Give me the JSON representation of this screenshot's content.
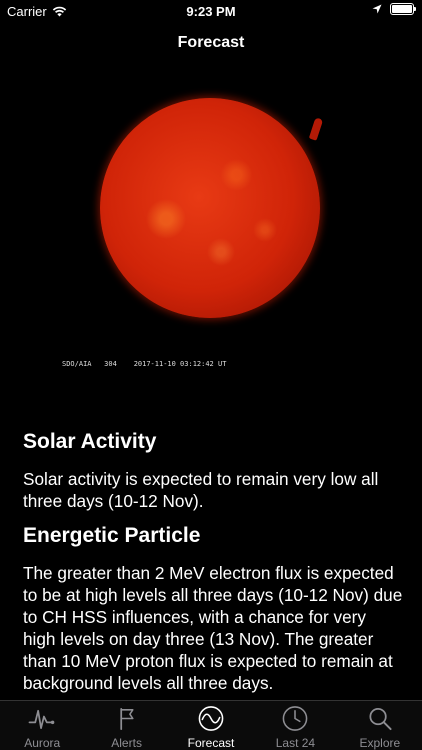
{
  "status_bar": {
    "carrier": "Carrier",
    "time": "9:23 PM",
    "battery_level": 1.0
  },
  "nav": {
    "title": "Forecast"
  },
  "sun_image": {
    "instrument": "SDO/AIA",
    "wavelength": "304",
    "timestamp": "2017-11-10 03:12:42 UT"
  },
  "sections": [
    {
      "title": "Solar Activity",
      "body": "Solar activity is expected to remain very low all three days (10-12 Nov)."
    },
    {
      "title": "Energetic Particle",
      "body": "The greater than 2 MeV electron flux is expected to be at high levels all three days (10-12 Nov) due to CH HSS influences, with a chance for very high levels on day three (13 Nov). The greater than 10 MeV proton flux is expected to remain at background levels all three days."
    }
  ],
  "tabs": [
    {
      "label": "Aurora",
      "icon": "pulse-icon"
    },
    {
      "label": "Alerts",
      "icon": "flag-icon"
    },
    {
      "label": "Forecast",
      "icon": "wave-icon",
      "active": true
    },
    {
      "label": "Last 24",
      "icon": "clock-icon"
    },
    {
      "label": "Explore",
      "icon": "search-icon"
    }
  ],
  "colors": {
    "background": "#000000",
    "sun": "#d02408",
    "tab_inactive": "#8e8e93",
    "tab_active": "#ffffff"
  }
}
